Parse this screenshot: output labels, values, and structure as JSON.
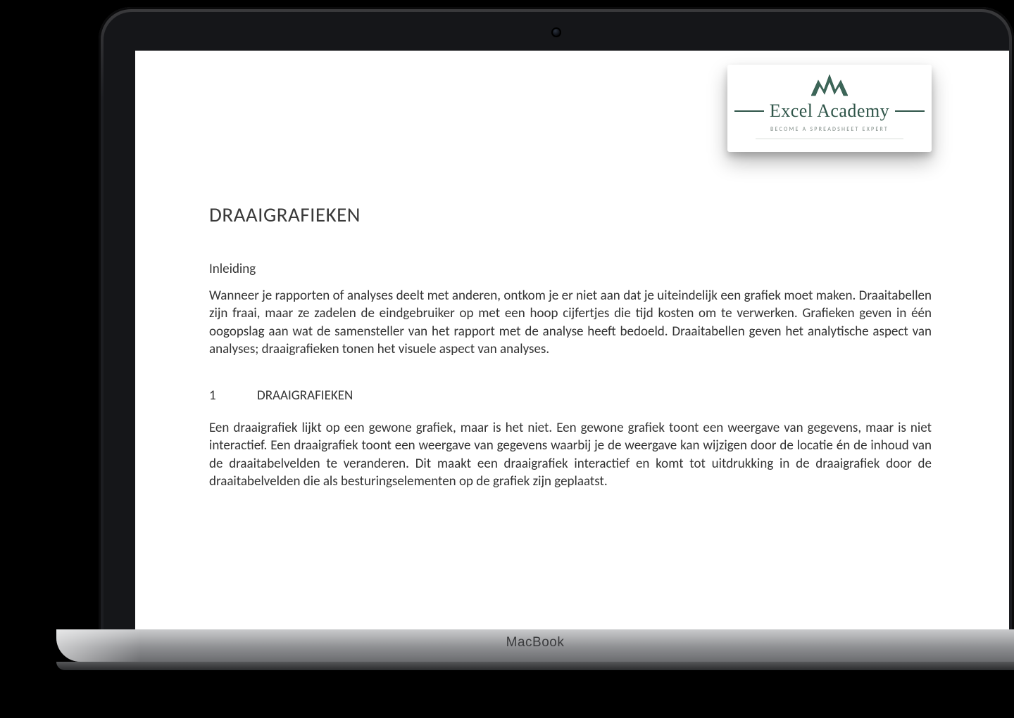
{
  "device": {
    "label": "MacBook"
  },
  "logo": {
    "title": "Excel Academy",
    "tagline": "BECOME A SPREADSHEET EXPERT"
  },
  "document": {
    "title": "DRAAIGRAFIEKEN",
    "intro_label": "Inleiding",
    "intro_body": "Wanneer je rapporten of analyses deelt met anderen, ontkom je er niet aan dat je uiteindelijk een grafiek moet maken. Draaitabellen zijn fraai, maar ze zadelen de eindgebruiker op met een hoop cijfertjes die tijd kosten om te verwerken. Grafieken geven in één oogopslag aan wat de samensteller van het rapport met de analyse heeft bedoeld. Draaitabellen geven het analytische aspect van analyses; draaigrafieken tonen het visuele aspect van analyses.",
    "section1": {
      "number": "1",
      "heading": "DRAAIGRAFIEKEN",
      "body": "Een draaigrafiek lijkt op een gewone grafiek, maar is het niet. Een gewone grafiek toont een weergave van gegevens, maar is niet interactief. Een draaigrafiek toont een weergave van gegevens waarbij je de weergave kan wijzigen door de locatie én de inhoud van de draaitabelvelden te veranderen. Dit maakt een draaigrafiek interactief en komt tot uitdrukking in de draaigrafiek door de draaitabelvelden die als besturingselementen op de grafiek zijn geplaatst."
    }
  }
}
